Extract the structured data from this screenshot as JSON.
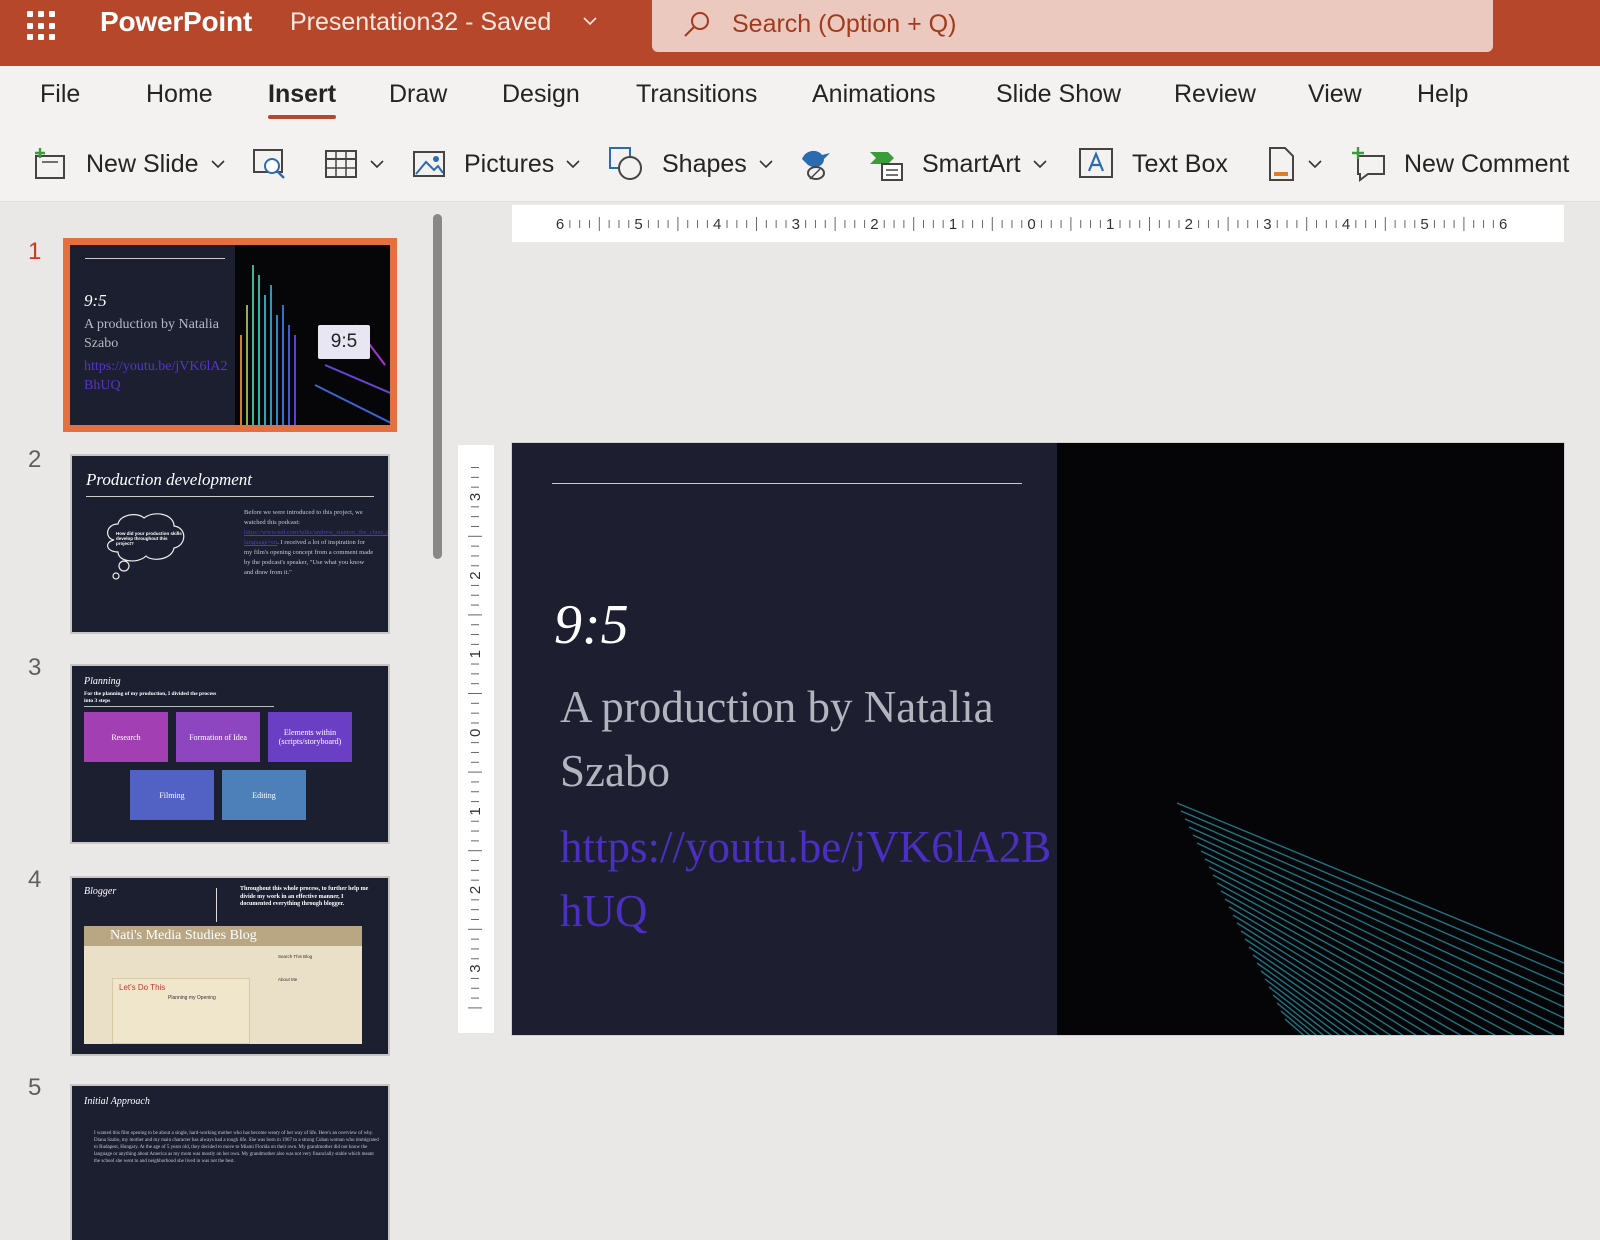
{
  "app": {
    "name": "PowerPoint",
    "doc_title": "Presentation32  -  Saved",
    "search_placeholder": "Search (Option + Q)"
  },
  "tabs": [
    "File",
    "Home",
    "Insert",
    "Draw",
    "Design",
    "Transitions",
    "Animations",
    "Slide Show",
    "Review",
    "View",
    "Help"
  ],
  "active_tab": "Insert",
  "ribbon": {
    "new_slide": "New Slide",
    "pictures": "Pictures",
    "shapes": "Shapes",
    "smartart": "SmartArt",
    "text_box": "Text Box",
    "new_comment": "New Comment"
  },
  "thumbnails": {
    "numbers": [
      "1",
      "2",
      "3",
      "4",
      "5"
    ],
    "s1": {
      "title": "9:5",
      "subtitle": "A production by Natalia Szabo",
      "link": "https://youtu.be/jVK6lA2BhUQ",
      "tag": "9:5"
    },
    "s2": {
      "title": "Production development",
      "cloud": "How did your production skills develop throughout this project?",
      "body_pre": "Before we were introduced to this project, we watched this podcast:",
      "body_link": "https://www.ted.com/talks/andrew_stanton_the_clues_to_a_great_story?language=en",
      "body_post": ". I received a lot of inspiration for my film's opening concept from a comment made by the podcast's speaker, \"Use what you know and draw from it.\""
    },
    "s3": {
      "title": "Planning",
      "sub": "For the planning of my production, I divided the process into 3 steps",
      "boxes": [
        "Research",
        "Formation of Idea",
        "Elements within (scripts/storyboard)",
        "Filming",
        "Editing"
      ]
    },
    "s4": {
      "title": "Blogger",
      "text": "Throughout this whole process, to further help me divide my work in an effective manner, I documented everything through blogger.",
      "blog_name": "Nati's Media Studies Blog",
      "post_title": "Let's Do This",
      "post_sub": "Planning my Opening",
      "side_search": "Search This Blog",
      "side_about": "About Me"
    },
    "s5": {
      "title": "Initial Approach",
      "text": "I wanted this film opening to be about a single, hard-working mother who has become weary of her way of life. Here's an overview of why. Diana Szabo, my mother and my main character has always had a tough life. She was born in 1967 to a strong Cuban woman who immigrated to Budapest, Hungary. At the age of 5 years old, they decided to move to Miami Florida on their own. My grandmother did not know the language or anything about America as my mom was mostly on her own. My grandmother also was not very financially stable which meant the school she went to and neighborhood she lived in was not the best."
    }
  },
  "slide": {
    "title": "9:5",
    "subtitle": "A production by Natalia Szabo",
    "link": "https://youtu.be/jVK6lA2BhUQ"
  },
  "ruler": {
    "h_labels": [
      "6",
      "5",
      "4",
      "3",
      "2",
      "1",
      "0",
      "1",
      "2",
      "3",
      "4",
      "5",
      "6"
    ],
    "v_labels": [
      "3",
      "2",
      "1",
      "0",
      "1",
      "2",
      "3"
    ]
  },
  "colors": {
    "brand": "#b7472a",
    "selection": "#e4703f",
    "slide_bg": "#1d1f30",
    "link": "#4b2fc0"
  }
}
